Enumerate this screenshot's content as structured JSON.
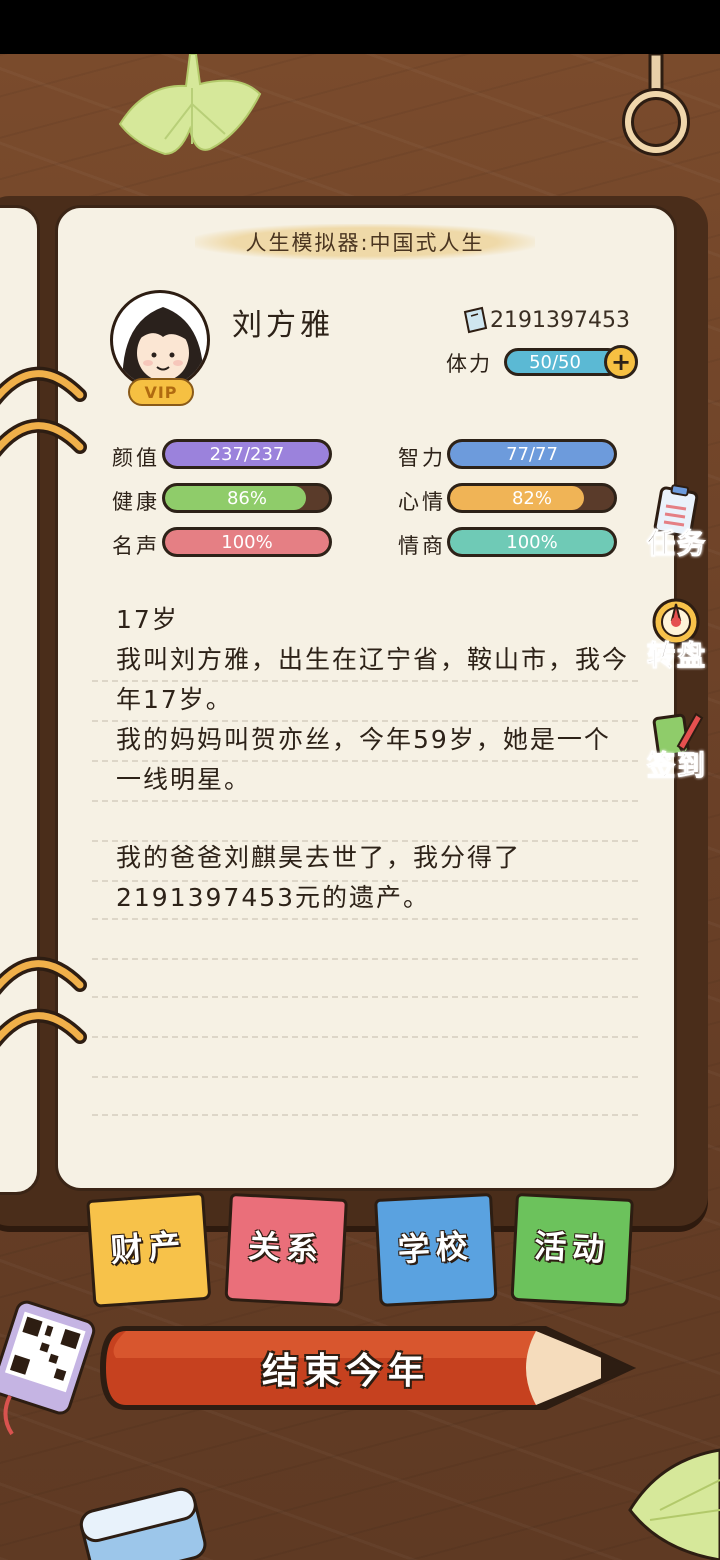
{
  "game": {
    "title": "人生模拟器:中国式人生"
  },
  "profile": {
    "name": "刘方雅",
    "vip_label": "VIP",
    "money": "2191397453",
    "stamina_label": "体力",
    "stamina_value": "50/50"
  },
  "stats": [
    {
      "label": "颜值",
      "value": "237/237",
      "fill": 1.0,
      "color": "#9b82dc"
    },
    {
      "label": "智力",
      "value": "77/77",
      "fill": 1.0,
      "color": "#6d9bdc"
    },
    {
      "label": "健康",
      "value": "86%",
      "fill": 0.86,
      "color": "#8fcc6a"
    },
    {
      "label": "心情",
      "value": "82%",
      "fill": 0.82,
      "color": "#f0b456"
    },
    {
      "label": "名声",
      "value": "100%",
      "fill": 1.0,
      "color": "#e57f84"
    },
    {
      "label": "情商",
      "value": "100%",
      "fill": 1.0,
      "color": "#6fcab6"
    }
  ],
  "story": {
    "age_heading": "17岁",
    "paragraph1": "我叫刘方雅，出生在辽宁省，鞍山市，我今年17岁。",
    "paragraph2": "我的妈妈叫贺亦丝，今年59岁，她是一个一线明星。",
    "paragraph3": "我的爸爸刘麒昊去世了，我分得了2191397453元的遗产。"
  },
  "side_buttons": {
    "tasks": "任务",
    "wheel": "转盘",
    "checkin": "签到"
  },
  "tabs": [
    {
      "label": "财产",
      "color": "#f7c24a"
    },
    {
      "label": "关系",
      "color": "#ea6f7a"
    },
    {
      "label": "学校",
      "color": "#5aa2e0"
    },
    {
      "label": "活动",
      "color": "#6cc25c"
    }
  ],
  "end_year_label": "结束今年"
}
